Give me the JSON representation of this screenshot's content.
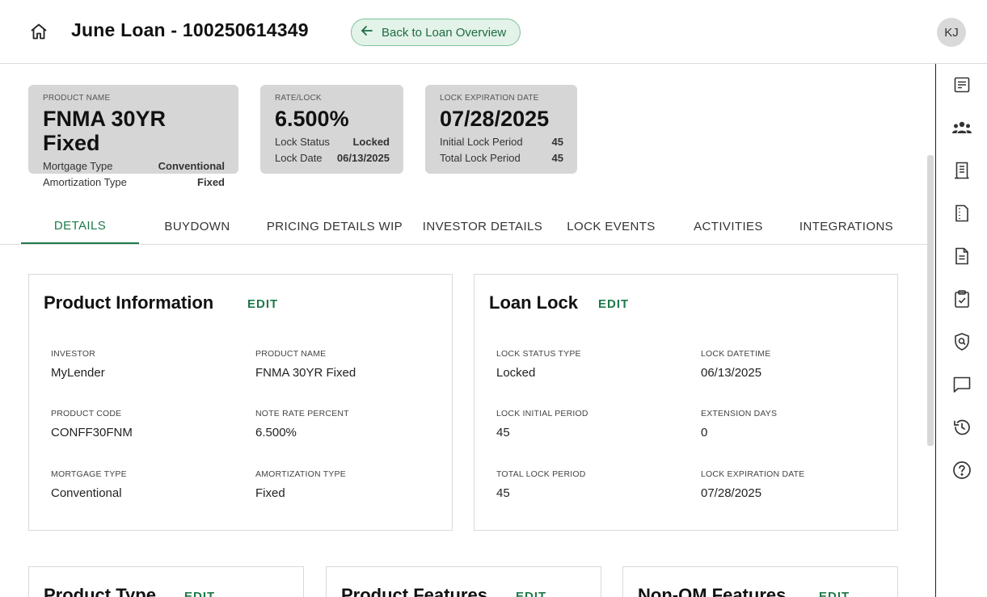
{
  "header": {
    "title": "June Loan - 100250614349",
    "back_label": "Back to Loan Overview",
    "avatar_initials": "KJ"
  },
  "summary": {
    "product": {
      "label": "PRODUCT NAME",
      "value": "FNMA 30YR Fixed",
      "rows": [
        {
          "k": "Mortgage Type",
          "v": "Conventional"
        },
        {
          "k": "Amortization Type",
          "v": "Fixed"
        }
      ]
    },
    "rate": {
      "label": "RATE/LOCK",
      "value": "6.500%",
      "rows": [
        {
          "k": "Lock Status",
          "v": "Locked"
        },
        {
          "k": "Lock Date",
          "v": "06/13/2025"
        }
      ]
    },
    "lock": {
      "label": "LOCK EXPIRATION DATE",
      "value": "07/28/2025",
      "rows": [
        {
          "k": "Initial Lock Period",
          "v": "45"
        },
        {
          "k": "Total Lock Period",
          "v": "45"
        }
      ]
    }
  },
  "tabs": [
    "DETAILS",
    "BUYDOWN",
    "PRICING DETAILS WIP",
    "INVESTOR DETAILS",
    "LOCK EVENTS",
    "ACTIVITIES",
    "INTEGRATIONS"
  ],
  "product_info": {
    "title": "Product Information",
    "edit": "EDIT",
    "fields": [
      {
        "label": "INVESTOR",
        "value": "MyLender"
      },
      {
        "label": "PRODUCT NAME",
        "value": "FNMA 30YR Fixed"
      },
      {
        "label": "PRODUCT CODE",
        "value": "CONFF30FNM"
      },
      {
        "label": "NOTE RATE PERCENT",
        "value": "6.500%"
      },
      {
        "label": "MORTGAGE TYPE",
        "value": "Conventional"
      },
      {
        "label": "AMORTIZATION TYPE",
        "value": "Fixed"
      }
    ]
  },
  "loan_lock": {
    "title": "Loan Lock",
    "edit": "EDIT",
    "fields": [
      {
        "label": "LOCK STATUS TYPE",
        "value": "Locked"
      },
      {
        "label": "LOCK DATETIME",
        "value": "06/13/2025"
      },
      {
        "label": "LOCK INITIAL PERIOD",
        "value": "45"
      },
      {
        "label": "EXTENSION DAYS",
        "value": "0"
      },
      {
        "label": "TOTAL LOCK PERIOD",
        "value": "45"
      },
      {
        "label": "LOCK EXPIRATION DATE",
        "value": "07/28/2025"
      }
    ]
  },
  "lower_cards": [
    {
      "title": "Product Type",
      "edit": "EDIT"
    },
    {
      "title": "Product Features",
      "edit": "EDIT"
    },
    {
      "title": "Non-QM Features",
      "edit": "EDIT"
    }
  ],
  "rail_icons": [
    "checklist-document-icon",
    "team-icon",
    "receipt-icon",
    "document-dashed-icon",
    "document-text-icon",
    "clipboard-check-icon",
    "shield-search-icon",
    "chat-icon",
    "history-icon",
    "help-icon"
  ],
  "colors": {
    "accent": "#1e7a4a",
    "back_bg": "#e3f3e9",
    "summary_bg": "#d6d6d6"
  }
}
